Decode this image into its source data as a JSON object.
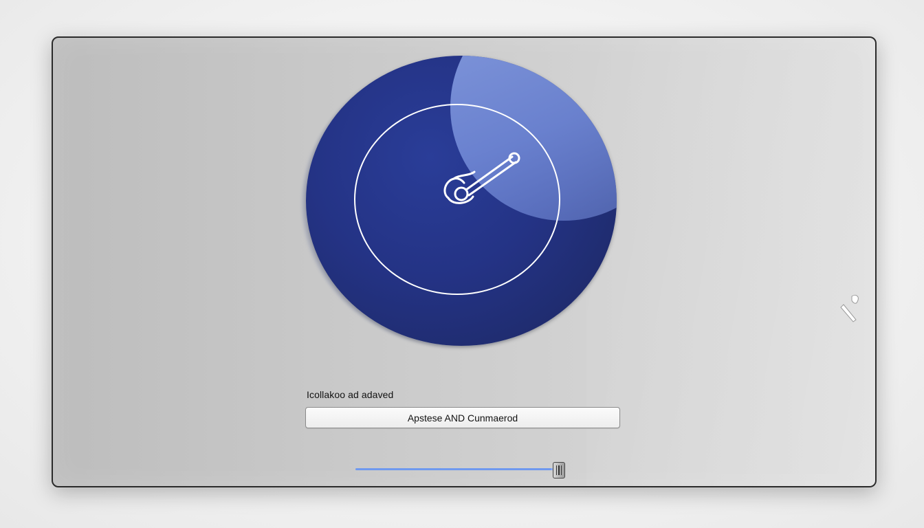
{
  "screen": {
    "status_text": "Icollakoo ad adaved",
    "button_label": "Apstese AND Cunmaerod",
    "progress_percent": 95,
    "icons": {
      "disc": "installer-disc-icon",
      "wand": "wand-icon",
      "cursor": "pointer-cursor-icon"
    },
    "colors": {
      "disc_blue": "#243385",
      "gloss_blue": "#7189d6",
      "progress_blue": "#6f99ef"
    }
  }
}
